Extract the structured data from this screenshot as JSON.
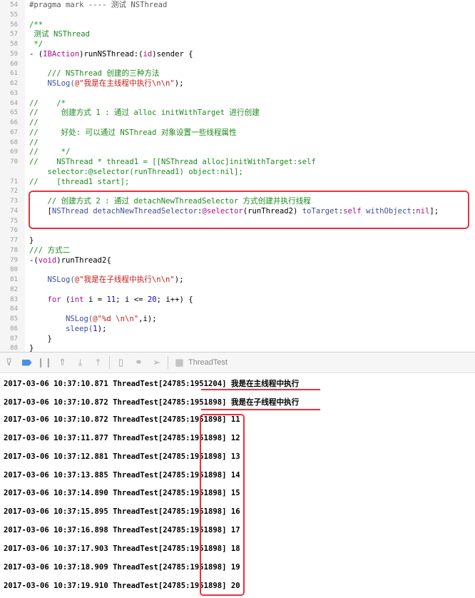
{
  "editor": {
    "lines": [
      {
        "n": "54",
        "segs": [
          {
            "t": "#pragma mark ---- 测试 NSThread",
            "c": "m"
          }
        ]
      },
      {
        "n": "55",
        "segs": []
      },
      {
        "n": "56",
        "segs": [
          {
            "t": "/**",
            "c": "c"
          }
        ]
      },
      {
        "n": "57",
        "segs": [
          {
            "t": " 测试 NSThread",
            "c": "c"
          }
        ]
      },
      {
        "n": "58",
        "segs": [
          {
            "t": " */",
            "c": "c"
          }
        ]
      },
      {
        "n": "59",
        "segs": [
          {
            "t": "- (",
            "c": ""
          },
          {
            "t": "IBAction",
            "c": "k"
          },
          {
            "t": ")runNSThread:(",
            "c": ""
          },
          {
            "t": "id",
            "c": "k"
          },
          {
            "t": ")sender {",
            "c": ""
          }
        ]
      },
      {
        "n": "60",
        "segs": []
      },
      {
        "n": "61",
        "segs": [
          {
            "t": "    /// NSThread 创建的三种方法",
            "c": "c"
          }
        ]
      },
      {
        "n": "62",
        "segs": [
          {
            "t": "    NSLog(",
            "c": "cl"
          },
          {
            "t": "@\"我是在主线程中执行\\n\\n\"",
            "c": "s"
          },
          {
            "t": ");",
            "c": ""
          }
        ]
      },
      {
        "n": "63",
        "segs": []
      },
      {
        "n": "64",
        "segs": [
          {
            "t": "//    /*",
            "c": "c"
          }
        ]
      },
      {
        "n": "65",
        "segs": [
          {
            "t": "//     创建方式 1 : 通过 alloc initWithTarget 进行创建",
            "c": "c"
          }
        ]
      },
      {
        "n": "66",
        "segs": [
          {
            "t": "//",
            "c": "c"
          }
        ]
      },
      {
        "n": "67",
        "segs": [
          {
            "t": "//     好处: 可以通过 NSThread 对象设置一些线程属性",
            "c": "c"
          }
        ]
      },
      {
        "n": "68",
        "segs": [
          {
            "t": "//",
            "c": "c"
          }
        ]
      },
      {
        "n": "69",
        "segs": [
          {
            "t": "//     */",
            "c": "c"
          }
        ]
      },
      {
        "n": "70",
        "segs": [
          {
            "t": "//    NSThread * thread1 = [[NSThread alloc]initWithTarget:self",
            "c": "c"
          }
        ]
      },
      {
        "n": "",
        "segs": [
          {
            "t": "    selector:@selector(runThread1) object:nil];",
            "c": "c"
          }
        ]
      },
      {
        "n": "71",
        "segs": [
          {
            "t": "//    [thread1 start];",
            "c": "c"
          }
        ]
      },
      {
        "n": "72",
        "segs": []
      },
      {
        "n": "73",
        "segs": [
          {
            "t": "    // 创建方式 2 : 通过 detachNewThreadSelector 方式创建并执行线程",
            "c": "c"
          }
        ]
      },
      {
        "n": "74",
        "segs": [
          {
            "t": "    [",
            "c": ""
          },
          {
            "t": "NSThread detachNewThreadSelector",
            "c": "cl"
          },
          {
            "t": ":",
            "c": ""
          },
          {
            "t": "@selector",
            "c": "k"
          },
          {
            "t": "(runThread2) ",
            "c": ""
          },
          {
            "t": "toTarget",
            "c": "cl"
          },
          {
            "t": ":",
            "c": ""
          },
          {
            "t": "self",
            "c": "k"
          },
          {
            "t": " withObject",
            "c": "cl"
          },
          {
            "t": ":",
            "c": ""
          },
          {
            "t": "nil",
            "c": "k"
          },
          {
            "t": "];",
            "c": ""
          }
        ]
      },
      {
        "n": "75",
        "segs": []
      },
      {
        "n": "76",
        "segs": []
      },
      {
        "n": "77",
        "segs": [
          {
            "t": "}",
            "c": ""
          }
        ]
      },
      {
        "n": "78",
        "segs": [
          {
            "t": "/// 方式二",
            "c": "c"
          }
        ]
      },
      {
        "n": "79",
        "segs": [
          {
            "t": "-(",
            "c": ""
          },
          {
            "t": "void",
            "c": "k"
          },
          {
            "t": ")runThread2{",
            "c": ""
          }
        ]
      },
      {
        "n": "80",
        "segs": []
      },
      {
        "n": "81",
        "segs": [
          {
            "t": "    NSLog(",
            "c": "cl"
          },
          {
            "t": "@\"我是在子线程中执行\\n\\n\"",
            "c": "s"
          },
          {
            "t": ");",
            "c": ""
          }
        ]
      },
      {
        "n": "82",
        "segs": []
      },
      {
        "n": "83",
        "segs": [
          {
            "t": "    ",
            "c": ""
          },
          {
            "t": "for",
            "c": "k"
          },
          {
            "t": " (",
            "c": ""
          },
          {
            "t": "int",
            "c": "k"
          },
          {
            "t": " i = ",
            "c": ""
          },
          {
            "t": "11",
            "c": "n"
          },
          {
            "t": "; i <= ",
            "c": ""
          },
          {
            "t": "20",
            "c": "n"
          },
          {
            "t": "; i++) {",
            "c": ""
          }
        ]
      },
      {
        "n": "84",
        "segs": []
      },
      {
        "n": "85",
        "segs": [
          {
            "t": "        NSLog(",
            "c": "cl"
          },
          {
            "t": "@\"%d \\n\\n\"",
            "c": "s"
          },
          {
            "t": ",i);",
            "c": ""
          }
        ]
      },
      {
        "n": "86",
        "segs": [
          {
            "t": "        sleep(",
            "c": "cl"
          },
          {
            "t": "1",
            "c": "n"
          },
          {
            "t": ");",
            "c": ""
          }
        ]
      },
      {
        "n": "87",
        "segs": [
          {
            "t": "    }",
            "c": ""
          }
        ]
      },
      {
        "n": "88",
        "segs": [
          {
            "t": "}",
            "c": ""
          }
        ]
      }
    ]
  },
  "toolbar": {
    "target_label": "ThreadTest"
  },
  "console": {
    "lines": [
      "2017-03-06 10:37:10.871 ThreadTest[24785:1951204] 我是在主线程中执行",
      "2017-03-06 10:37:10.872 ThreadTest[24785:1951898] 我是在子线程中执行",
      "2017-03-06 10:37:10.872 ThreadTest[24785:1951898] 11",
      "2017-03-06 10:37:11.877 ThreadTest[24785:1951898] 12",
      "2017-03-06 10:37:12.881 ThreadTest[24785:1951898] 13",
      "2017-03-06 10:37:13.885 ThreadTest[24785:1951898] 14",
      "2017-03-06 10:37:14.890 ThreadTest[24785:1951898] 15",
      "2017-03-06 10:37:15.895 ThreadTest[24785:1951898] 16",
      "2017-03-06 10:37:16.898 ThreadTest[24785:1951898] 17",
      "2017-03-06 10:37:17.903 ThreadTest[24785:1951898] 18",
      "2017-03-06 10:37:18.909 ThreadTest[24785:1951898] 19",
      "2017-03-06 10:37:19.910 ThreadTest[24785:1951898] 20"
    ]
  },
  "colors": {
    "annotation": "#e8323f",
    "comment": "#1f8a1f",
    "string": "#c41a16",
    "keyword": "#aa0d91"
  }
}
